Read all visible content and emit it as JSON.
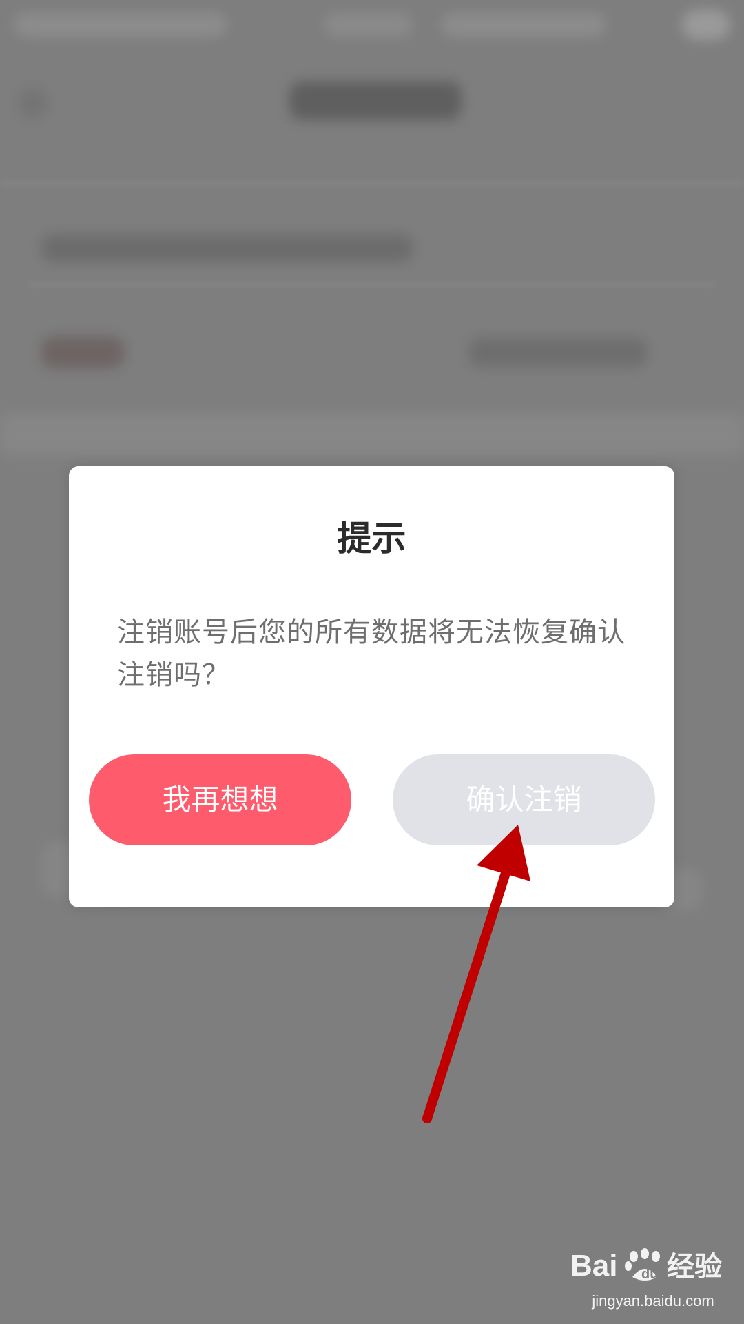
{
  "dialog": {
    "title": "提示",
    "message": "注销账号后您的所有数据将无法恢复确认注销吗？",
    "cancel_label": "我再想想",
    "confirm_label": "确认注销"
  },
  "watermark": {
    "logo_text": "Baidu经验",
    "url": "jingyan.baidu.com"
  },
  "colors": {
    "overlay": "#808080",
    "dialog_bg": "#ffffff",
    "cancel_button": "#fe5b6d",
    "confirm_button": "#e1e2e7",
    "annotation_arrow": "#c00000"
  },
  "icons": {
    "annotation": "red-arrow-pointing-to-confirm"
  }
}
